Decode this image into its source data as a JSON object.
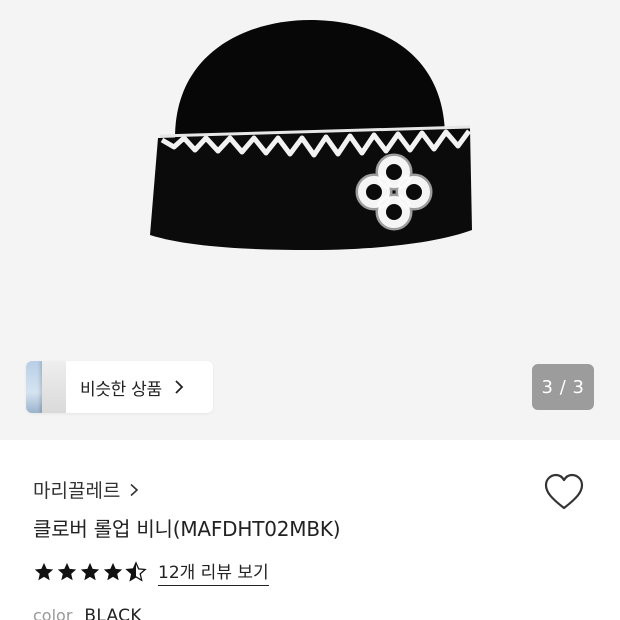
{
  "gallery": {
    "image_alt": "클로버 롤업 비니 black knit beanie",
    "similar_label": "비슷한 상품",
    "page_current": "3",
    "page_total": "3",
    "page_counter": "3 / 3"
  },
  "product": {
    "brand": "마리끌레르",
    "title": "클로버 롤업 비니(MAFDHT02MBK)",
    "rating": 4.5,
    "review_link": "12개 리뷰 보기",
    "color_label": "color",
    "color_value": "BLACK"
  },
  "colors": {
    "gallery_bg": "#f4f4f4",
    "counter_bg": "#9c9c9c",
    "text": "#222222",
    "muted": "#999999"
  },
  "icons": {
    "similar_chevron": "chevron-right-icon",
    "brand_chevron": "chevron-right-icon",
    "wish": "heart-outline-icon",
    "star": "star-icon"
  }
}
